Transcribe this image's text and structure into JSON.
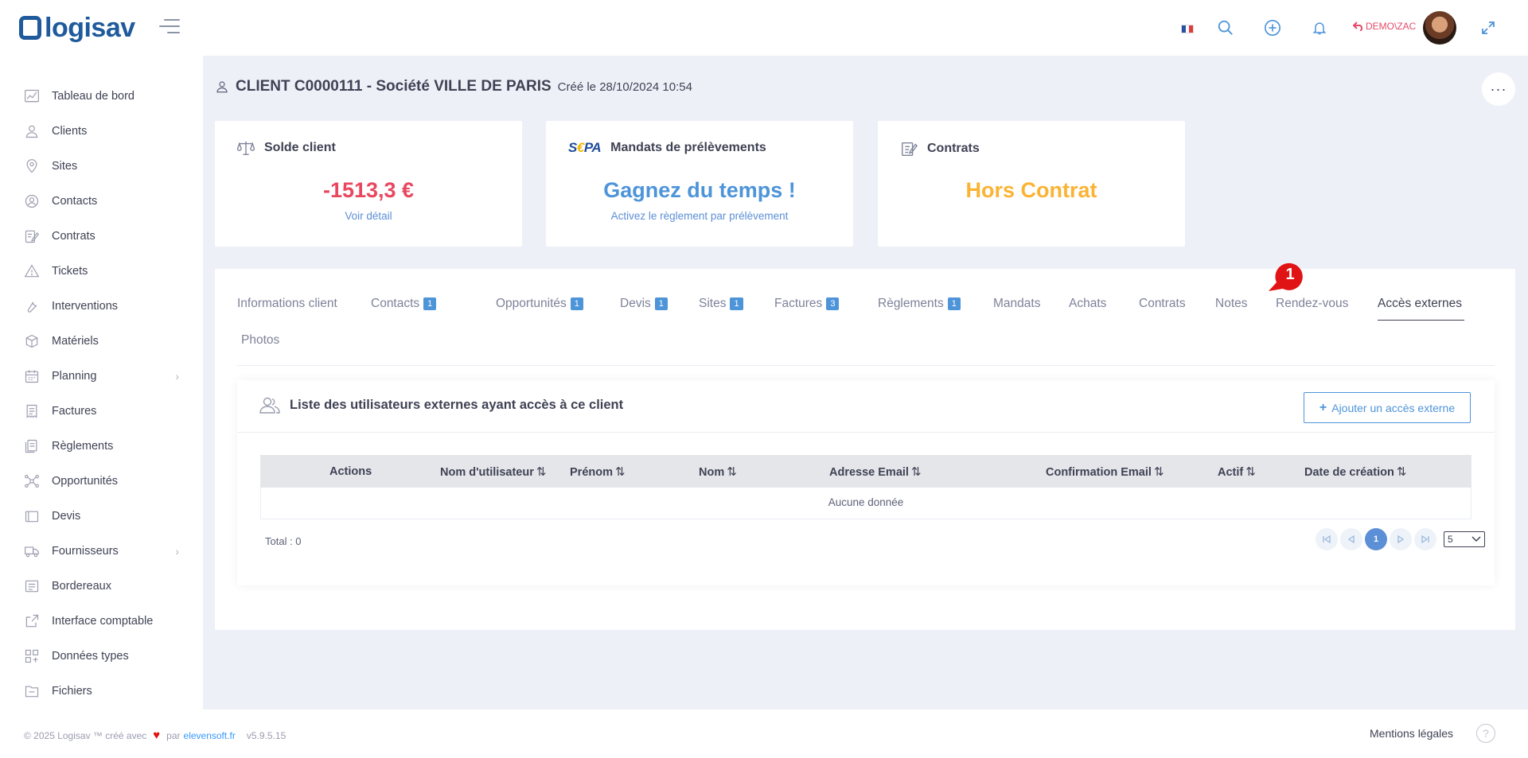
{
  "header": {
    "logo_text": "logisav",
    "user_label": "DEMO\\ZAC",
    "colors": {
      "brand": "#1f5a9c",
      "accent": "#3699ff"
    }
  },
  "sidebar": {
    "items": [
      {
        "label": "Tableau de bord",
        "icon": "chart-icon"
      },
      {
        "label": "Clients",
        "icon": "user-icon"
      },
      {
        "label": "Sites",
        "icon": "map-pin-icon"
      },
      {
        "label": "Contacts",
        "icon": "contacts-icon"
      },
      {
        "label": "Contrats",
        "icon": "edit-document-icon"
      },
      {
        "label": "Tickets",
        "icon": "warning-icon"
      },
      {
        "label": "Interventions",
        "icon": "wrench-icon"
      },
      {
        "label": "Matériels",
        "icon": "box-icon"
      },
      {
        "label": "Planning",
        "icon": "calendar-icon",
        "submenu": true
      },
      {
        "label": "Factures",
        "icon": "invoice-icon"
      },
      {
        "label": "Règlements",
        "icon": "payments-icon"
      },
      {
        "label": "Opportunités",
        "icon": "network-icon"
      },
      {
        "label": "Devis",
        "icon": "folder-icon"
      },
      {
        "label": "Fournisseurs",
        "icon": "truck-icon",
        "submenu": true
      },
      {
        "label": "Bordereaux",
        "icon": "slip-icon"
      },
      {
        "label": "Interface comptable",
        "icon": "external-link-icon"
      },
      {
        "label": "Données types",
        "icon": "grid-icon"
      },
      {
        "label": "Fichiers",
        "icon": "file-icon"
      }
    ]
  },
  "page": {
    "title": "CLIENT C0000111 - Société VILLE DE PARIS",
    "subtitle": "Créé le 28/10/2024 10:54",
    "more": "···"
  },
  "cards": {
    "solde": {
      "title": "Solde client",
      "value": "-1513,3 €",
      "link": "Voir détail",
      "color": "#e8475f"
    },
    "mandats": {
      "title": "Mandats de prélèvements",
      "logo": "SEPA",
      "value": "Gagnez du temps !",
      "link": "Activez le règlement par prélèvement",
      "color": "#4d94d9"
    },
    "contrats": {
      "title": "Contrats",
      "value": "Hors Contrat",
      "color": "#fbb334"
    }
  },
  "tabs": [
    {
      "label": "Informations client"
    },
    {
      "label": "Contacts",
      "count": "1"
    },
    {
      "label": "Opportunités",
      "count": "1"
    },
    {
      "label": "Devis",
      "count": "1"
    },
    {
      "label": "Sites",
      "count": "1"
    },
    {
      "label": "Factures",
      "count": "3"
    },
    {
      "label": "Règlements",
      "count": "1"
    },
    {
      "label": "Mandats"
    },
    {
      "label": "Achats"
    },
    {
      "label": "Contrats"
    },
    {
      "label": "Notes"
    },
    {
      "label": "Rendez-vous"
    },
    {
      "label": "Accès externes",
      "active": true
    },
    {
      "label": "Photos"
    }
  ],
  "external_access": {
    "title": "Liste des utilisateurs externes ayant accès à ce client",
    "add_button": "Ajouter un accès externe",
    "marker": "1",
    "columns": [
      "Actions",
      "Nom d'utilisateur",
      "Prénom",
      "Nom",
      "Adresse Email",
      "Confirmation Email",
      "Actif",
      "Date de création"
    ],
    "sort_glyph": "⇅",
    "empty_text": "Aucune donnée",
    "total": "Total : 0",
    "pager": {
      "current": "1",
      "per_page": "5"
    }
  },
  "footer": {
    "copyright": "© 2025 Logisav ™ créé avec",
    "by": "par",
    "link": "elevensoft.fr",
    "version": "v5.9.5.15",
    "legal": "Mentions légales",
    "help": "?"
  }
}
